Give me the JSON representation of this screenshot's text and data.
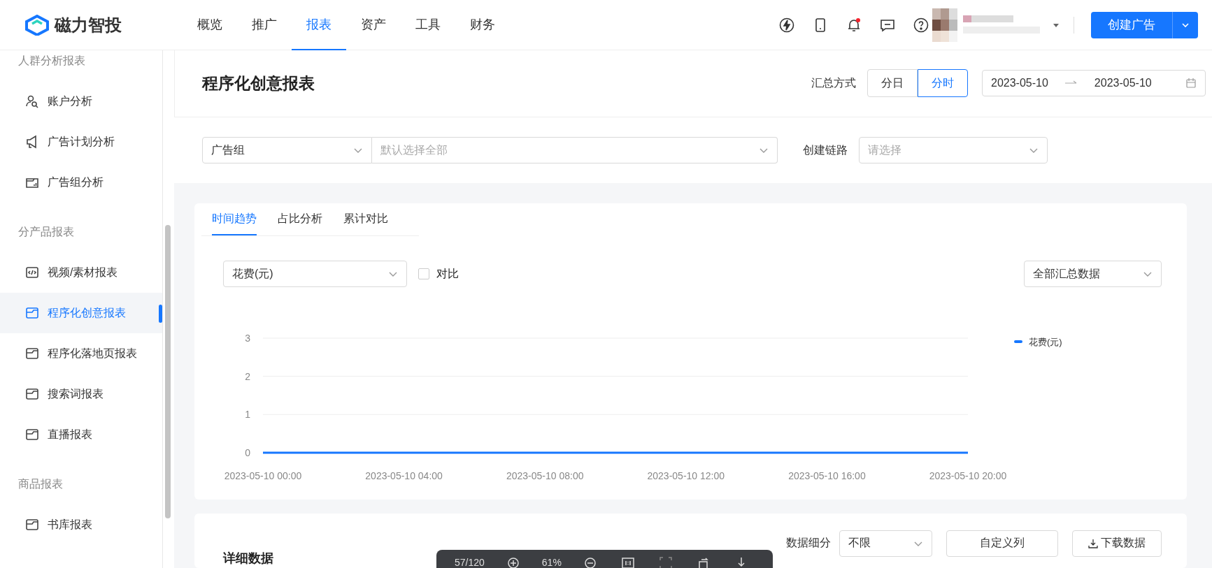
{
  "brand": {
    "name": "磁力智投"
  },
  "nav": [
    {
      "label": "概览",
      "selected": false
    },
    {
      "label": "推广",
      "selected": false
    },
    {
      "label": "报表",
      "selected": true
    },
    {
      "label": "资产",
      "selected": false
    },
    {
      "label": "工具",
      "selected": false
    },
    {
      "label": "财务",
      "selected": false
    }
  ],
  "header_actions": {
    "create_button": "创建广告"
  },
  "sidebar": {
    "sections": [
      {
        "title": "人群分析报表",
        "items": [
          {
            "label": "账户分析",
            "kind": "person",
            "selected": false
          },
          {
            "label": "广告计划分析",
            "kind": "megaphone",
            "selected": false
          },
          {
            "label": "广告组分析",
            "kind": "chart",
            "selected": false
          }
        ]
      },
      {
        "title": "分产品报表",
        "items": [
          {
            "label": "视频/素材报表",
            "kind": "code",
            "selected": false
          },
          {
            "label": "程序化创意报表",
            "kind": "folder",
            "selected": true
          },
          {
            "label": "程序化落地页报表",
            "kind": "folder",
            "selected": false
          },
          {
            "label": "搜索词报表",
            "kind": "folder",
            "selected": false
          },
          {
            "label": "直播报表",
            "kind": "folder",
            "selected": false
          }
        ]
      },
      {
        "title": "商品报表",
        "items": [
          {
            "label": "书库报表",
            "kind": "folder",
            "selected": false
          }
        ]
      }
    ]
  },
  "page": {
    "title": "程序化创意报表",
    "summary_label": "汇总方式",
    "summary_options": [
      {
        "label": "分日",
        "selected": false
      },
      {
        "label": "分时",
        "selected": true
      }
    ],
    "date_start": "2023-05-10",
    "date_end": "2023-05-10"
  },
  "filters": {
    "group_select": "广告组",
    "group_placeholder": "默认选择全部",
    "link_label": "创建链路",
    "link_placeholder": "请选择"
  },
  "chart_card": {
    "tabs": [
      {
        "label": "时间趋势",
        "selected": true
      },
      {
        "label": "占比分析",
        "selected": false
      },
      {
        "label": "累计对比",
        "selected": false
      }
    ],
    "metric_select": "花费(元)",
    "compare": {
      "label": "对比",
      "checked": false
    },
    "scope_select": "全部汇总数据",
    "chart_data": {
      "type": "line",
      "categories": [
        "2023-05-10 00:00",
        null,
        null,
        null,
        "2023-05-10 04:00",
        null,
        null,
        null,
        "2023-05-10 08:00",
        null,
        null,
        null,
        "2023-05-10 12:00",
        null,
        null,
        null,
        "2023-05-10 16:00",
        null,
        null,
        null,
        "2023-05-10 20:00"
      ],
      "ylim": [
        0,
        3
      ],
      "yticks": [
        0,
        1,
        2,
        3
      ],
      "series": [
        {
          "name": "花费(元)",
          "color": "#1677ff",
          "values": [
            0,
            0,
            0,
            0,
            0,
            0,
            0,
            0,
            0,
            0,
            0,
            0,
            0,
            0,
            0,
            0,
            0,
            0,
            0,
            0,
            0
          ]
        }
      ]
    }
  },
  "detail_card": {
    "title": "详细数据",
    "breakdown_label": "数据细分",
    "breakdown_select": "不限",
    "columns_button": "自定义列",
    "download_button": "下载数据"
  },
  "viewer_toolbar": {
    "page": "57/120",
    "zoom": "61%"
  }
}
